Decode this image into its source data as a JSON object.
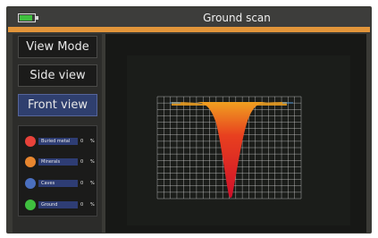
{
  "app": {
    "title": "Ground scan",
    "battery_level": 0.85,
    "accent_color": "#e2953a"
  },
  "menu": {
    "view_mode_label": "View Mode",
    "side_view_label": "Side view",
    "front_view_label": "Front view",
    "active_view": "Front view"
  },
  "legend": {
    "items": [
      {
        "label": "Buried metal",
        "value": "0",
        "unit": "%",
        "color": "#e8423a"
      },
      {
        "label": "Minerals",
        "value": "0",
        "unit": "%",
        "color": "#e8862f"
      },
      {
        "label": "Caves",
        "value": "0",
        "unit": "%",
        "color": "#4a6fbf"
      },
      {
        "label": "Ground",
        "value": "0",
        "unit": "%",
        "color": "#3fbf3f"
      }
    ]
  },
  "scan": {
    "view": "front",
    "grid": true,
    "grid_color": "#d8d8d8",
    "gradient_colors": [
      "#f0a020",
      "#e8401f",
      "#d0102a"
    ]
  }
}
